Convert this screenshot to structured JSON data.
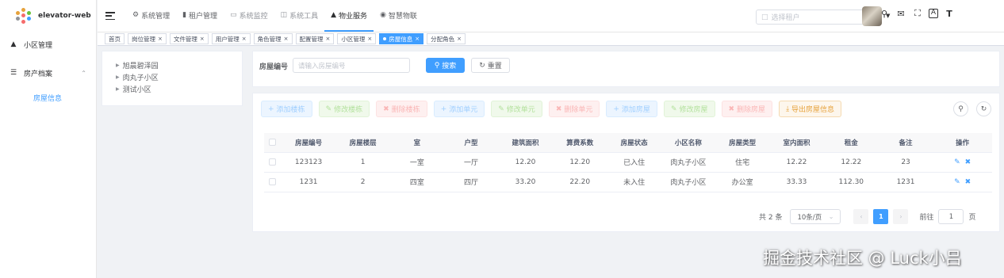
{
  "app": {
    "title": "elevator-web"
  },
  "sidebar": {
    "items": [
      {
        "label": "小区管理",
        "icon": "network-icon"
      },
      {
        "label": "房产档案",
        "icon": "list-icon",
        "expanded": true,
        "children": [
          {
            "label": "房屋信息",
            "active": true
          }
        ]
      }
    ]
  },
  "topnav": [
    {
      "label": "系统管理",
      "icon": "gear-icon"
    },
    {
      "label": "租户管理",
      "icon": "bar-chart-icon"
    },
    {
      "label": "系统监控",
      "icon": "monitor-icon",
      "dim": true
    },
    {
      "label": "系统工具",
      "icon": "tool-icon",
      "dim": true
    },
    {
      "label": "物业服务",
      "icon": "hierarchy-icon",
      "active": true
    },
    {
      "label": "智慧物联",
      "icon": "gamepad-icon"
    }
  ],
  "tenant_select": {
    "placeholder": "选择租户"
  },
  "tags": [
    {
      "label": "首页",
      "closable": false
    },
    {
      "label": "岗位管理",
      "closable": true
    },
    {
      "label": "文件管理",
      "closable": true
    },
    {
      "label": "用户管理",
      "closable": true
    },
    {
      "label": "角色管理",
      "closable": true
    },
    {
      "label": "配置管理",
      "closable": true
    },
    {
      "label": "小区管理",
      "closable": true
    },
    {
      "label": "房屋信息",
      "closable": true,
      "active": true
    },
    {
      "label": "分配角色",
      "closable": true
    }
  ],
  "tree": [
    "旭晨碧泽园",
    "肉丸子小区",
    "测试小区"
  ],
  "search": {
    "label": "房屋编号",
    "placeholder": "请输入房屋编号",
    "search_label": "搜索",
    "reset_label": "重置"
  },
  "actions": [
    {
      "label": "添加楼栋",
      "style": "blue",
      "icon": "+"
    },
    {
      "label": "修改楼栋",
      "style": "green",
      "icon": "✎"
    },
    {
      "label": "删除楼栋",
      "style": "red",
      "icon": "🗑"
    },
    {
      "label": "添加单元",
      "style": "blue",
      "icon": "+"
    },
    {
      "label": "修改单元",
      "style": "green",
      "icon": "✎"
    },
    {
      "label": "删除单元",
      "style": "red",
      "icon": "🗑"
    },
    {
      "label": "添加房屋",
      "style": "blue",
      "icon": "+"
    },
    {
      "label": "修改房屋",
      "style": "green",
      "icon": "✎"
    },
    {
      "label": "删除房屋",
      "style": "red",
      "icon": "🗑"
    },
    {
      "label": "导出房屋信息",
      "style": "orange",
      "icon": "⤓"
    }
  ],
  "table": {
    "columns": [
      "房屋编号",
      "房屋楼层",
      "室",
      "户型",
      "建筑面积",
      "算费系数",
      "房屋状态",
      "小区名称",
      "房屋类型",
      "室内面积",
      "租金",
      "备注",
      "操作"
    ],
    "rows": [
      [
        "123123",
        "1",
        "一室",
        "一厅",
        "12.20",
        "12.20",
        "已入住",
        "肉丸子小区",
        "住宅",
        "12.22",
        "12.22",
        "23"
      ],
      [
        "1231",
        "2",
        "四室",
        "四厅",
        "33.20",
        "22.20",
        "未入住",
        "肉丸子小区",
        "办公室",
        "33.33",
        "112.30",
        "1231"
      ]
    ]
  },
  "pagination": {
    "total_text": "共 2 条",
    "page_size": "10条/页",
    "current_page": "1",
    "goto_label": "前往",
    "goto_value": "1",
    "page_suffix": "页"
  },
  "watermark": "掘金技术社区 @ Luck小吕",
  "colors": {
    "primary": "#409eff",
    "warning": "#e6a23c"
  }
}
